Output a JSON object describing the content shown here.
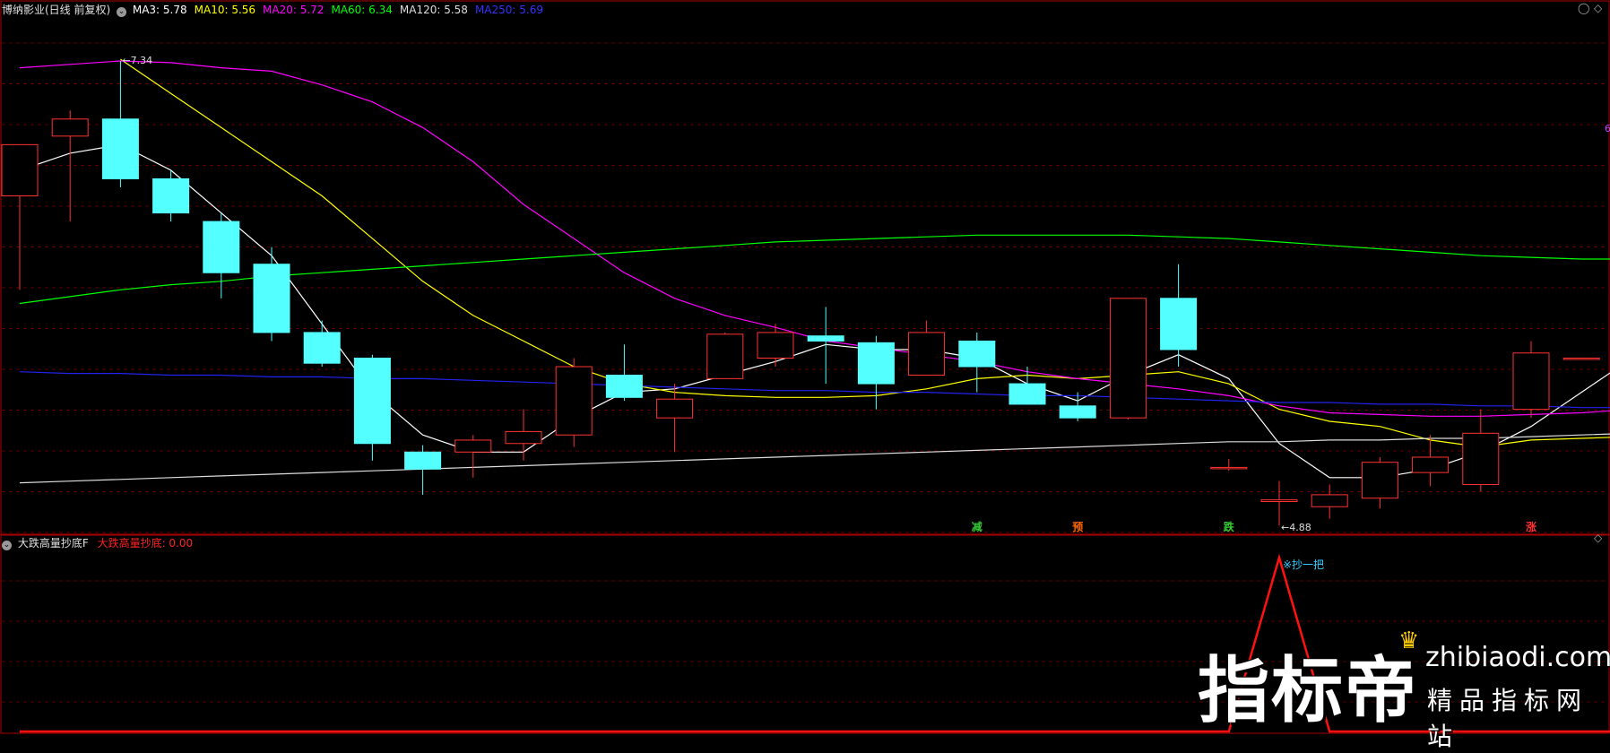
{
  "main_panel": {
    "title": "博纳影业(日线 前复权)",
    "ma_labels": [
      {
        "text": "MA3: 5.78",
        "color": "#ffffff"
      },
      {
        "text": "MA10: 5.56",
        "color": "#ffff00"
      },
      {
        "text": "MA20: 5.72",
        "color": "#ff00ff"
      },
      {
        "text": "MA60: 6.34",
        "color": "#00ff00"
      },
      {
        "text": "MA120: 5.58",
        "color": "#dddddd"
      },
      {
        "text": "MA250: 5.69",
        "color": "#3333ff"
      }
    ],
    "high_label": "7.34",
    "low_label": "4.88",
    "right_edge_mark": "6",
    "signals": [
      {
        "text": "减",
        "color": "#33cc33",
        "index": 19
      },
      {
        "text": "预",
        "color": "#ff6600",
        "index": 21
      },
      {
        "text": "跌",
        "color": "#33cc33",
        "index": 24
      },
      {
        "text": "涨",
        "color": "#ff3333",
        "index": 30
      }
    ]
  },
  "sub_panel": {
    "title": "大跌高量抄底F",
    "series_label": "大跌高量抄底: 0.00",
    "annotation": "※抄一把"
  },
  "watermark": {
    "main": "指标帝",
    "url": "zhibiaodi.com",
    "slogan": "精品指标网站"
  },
  "chart_data": {
    "type": "candlestick",
    "y_range": [
      4.6,
      7.55
    ],
    "ohlc": [
      {
        "o": 6.55,
        "h": 6.85,
        "l": 6.0,
        "c": 6.85
      },
      {
        "o": 6.9,
        "h": 7.05,
        "l": 6.4,
        "c": 7.0
      },
      {
        "o": 7.0,
        "h": 7.34,
        "l": 6.6,
        "c": 6.65
      },
      {
        "o": 6.65,
        "h": 6.7,
        "l": 6.4,
        "c": 6.45
      },
      {
        "o": 6.4,
        "h": 6.45,
        "l": 5.95,
        "c": 6.1
      },
      {
        "o": 6.15,
        "h": 6.25,
        "l": 5.7,
        "c": 5.75
      },
      {
        "o": 5.75,
        "h": 5.82,
        "l": 5.55,
        "c": 5.57
      },
      {
        "o": 5.6,
        "h": 5.62,
        "l": 5.0,
        "c": 5.1
      },
      {
        "o": 5.05,
        "h": 5.09,
        "l": 4.8,
        "c": 4.95
      },
      {
        "o": 5.05,
        "h": 5.15,
        "l": 4.9,
        "c": 5.12
      },
      {
        "o": 5.1,
        "h": 5.3,
        "l": 5.0,
        "c": 5.17
      },
      {
        "o": 5.15,
        "h": 5.6,
        "l": 5.08,
        "c": 5.55
      },
      {
        "o": 5.5,
        "h": 5.68,
        "l": 5.35,
        "c": 5.37
      },
      {
        "o": 5.25,
        "h": 5.45,
        "l": 5.05,
        "c": 5.36
      },
      {
        "o": 5.48,
        "h": 5.75,
        "l": 5.48,
        "c": 5.74
      },
      {
        "o": 5.6,
        "h": 5.8,
        "l": 5.55,
        "c": 5.75
      },
      {
        "o": 5.73,
        "h": 5.9,
        "l": 5.45,
        "c": 5.7
      },
      {
        "o": 5.69,
        "h": 5.73,
        "l": 5.3,
        "c": 5.45
      },
      {
        "o": 5.5,
        "h": 5.82,
        "l": 5.5,
        "c": 5.75
      },
      {
        "o": 5.7,
        "h": 5.75,
        "l": 5.4,
        "c": 5.55
      },
      {
        "o": 5.45,
        "h": 5.55,
        "l": 5.35,
        "c": 5.33
      },
      {
        "o": 5.32,
        "h": 5.4,
        "l": 5.23,
        "c": 5.25
      },
      {
        "o": 5.25,
        "h": 5.95,
        "l": 5.24,
        "c": 5.95
      },
      {
        "o": 5.95,
        "h": 6.15,
        "l": 5.55,
        "c": 5.65
      },
      {
        "o": 4.96,
        "h": 5.01,
        "l": 4.94,
        "c": 4.96
      },
      {
        "o": 4.76,
        "h": 4.88,
        "l": 4.62,
        "c": 4.77
      },
      {
        "o": 4.73,
        "h": 4.86,
        "l": 4.66,
        "c": 4.8
      },
      {
        "o": 4.78,
        "h": 5.02,
        "l": 4.72,
        "c": 4.99
      },
      {
        "o": 4.93,
        "h": 5.15,
        "l": 4.85,
        "c": 5.02
      },
      {
        "o": 4.86,
        "h": 5.3,
        "l": 4.82,
        "c": 5.16
      },
      {
        "o": 5.3,
        "h": 5.7,
        "l": 5.25,
        "c": 5.63
      },
      {
        "o": 5.6,
        "h": 5.6,
        "l": 5.6,
        "c": 5.6
      },
      {
        "o": 5.67,
        "h": 6.1,
        "l": 5.67,
        "c": 6.05
      }
    ],
    "ma": [
      {
        "name": "MA3",
        "color": "#ffffff",
        "values": [
          6.7,
          6.8,
          6.85,
          6.7,
          6.45,
          6.2,
          5.8,
          5.4,
          5.15,
          5.05,
          5.05,
          5.25,
          5.4,
          5.42,
          5.5,
          5.58,
          5.68,
          5.65,
          5.65,
          5.6,
          5.45,
          5.35,
          5.5,
          5.62,
          5.48,
          5.1,
          4.9,
          4.9,
          4.95,
          5.05,
          5.2,
          5.4,
          5.6
        ]
      },
      {
        "name": "MA10",
        "color": "#ffff00",
        "values": [
          null,
          null,
          7.35,
          7.15,
          6.95,
          6.75,
          6.55,
          6.3,
          6.05,
          5.85,
          5.7,
          5.55,
          5.45,
          5.4,
          5.38,
          5.37,
          5.37,
          5.38,
          5.42,
          5.48,
          5.5,
          5.48,
          5.5,
          5.52,
          5.45,
          5.3,
          5.23,
          5.2,
          5.12,
          5.08,
          5.12,
          5.13,
          5.14
        ]
      },
      {
        "name": "MA20",
        "color": "#ff00ff",
        "values": [
          7.3,
          7.32,
          7.34,
          7.33,
          7.3,
          7.28,
          7.2,
          7.1,
          6.95,
          6.75,
          6.5,
          6.3,
          6.1,
          5.95,
          5.85,
          5.78,
          5.7,
          5.66,
          5.62,
          5.58,
          5.52,
          5.48,
          5.45,
          5.42,
          5.38,
          5.32,
          5.28,
          5.27,
          5.26,
          5.26,
          5.27,
          5.28,
          5.3
        ]
      },
      {
        "name": "MA60",
        "color": "#00ff00",
        "values": [
          5.92,
          5.96,
          6.0,
          6.03,
          6.05,
          6.08,
          6.1,
          6.12,
          6.14,
          6.16,
          6.18,
          6.2,
          6.22,
          6.24,
          6.26,
          6.28,
          6.29,
          6.3,
          6.31,
          6.32,
          6.32,
          6.32,
          6.32,
          6.31,
          6.3,
          6.28,
          6.26,
          6.24,
          6.22,
          6.2,
          6.19,
          6.18,
          6.18
        ]
      },
      {
        "name": "MA120",
        "color": "#dddddd",
        "values": [
          4.87,
          4.88,
          4.89,
          4.9,
          4.91,
          4.92,
          4.93,
          4.94,
          4.95,
          4.96,
          4.97,
          4.98,
          4.99,
          5.0,
          5.01,
          5.02,
          5.03,
          5.04,
          5.05,
          5.06,
          5.07,
          5.08,
          5.09,
          5.1,
          5.11,
          5.11,
          5.12,
          5.12,
          5.13,
          5.13,
          5.14,
          5.15,
          5.16
        ]
      },
      {
        "name": "MA250",
        "color": "#2222ee",
        "values": [
          5.52,
          5.51,
          5.51,
          5.5,
          5.5,
          5.49,
          5.49,
          5.48,
          5.48,
          5.47,
          5.46,
          5.45,
          5.44,
          5.43,
          5.42,
          5.41,
          5.41,
          5.4,
          5.4,
          5.39,
          5.38,
          5.38,
          5.37,
          5.36,
          5.35,
          5.34,
          5.34,
          5.33,
          5.33,
          5.32,
          5.32,
          5.31,
          5.31
        ]
      }
    ],
    "subchart": {
      "name": "大跌高量抄底",
      "values": [
        0,
        0,
        0,
        0,
        0,
        0,
        0,
        0,
        0,
        0,
        0,
        0,
        0,
        0,
        0,
        0,
        0,
        0,
        0,
        0,
        0,
        0,
        0,
        0,
        0,
        1,
        0,
        0,
        0,
        0,
        0,
        0,
        0
      ],
      "y_range": [
        0,
        1
      ]
    }
  }
}
